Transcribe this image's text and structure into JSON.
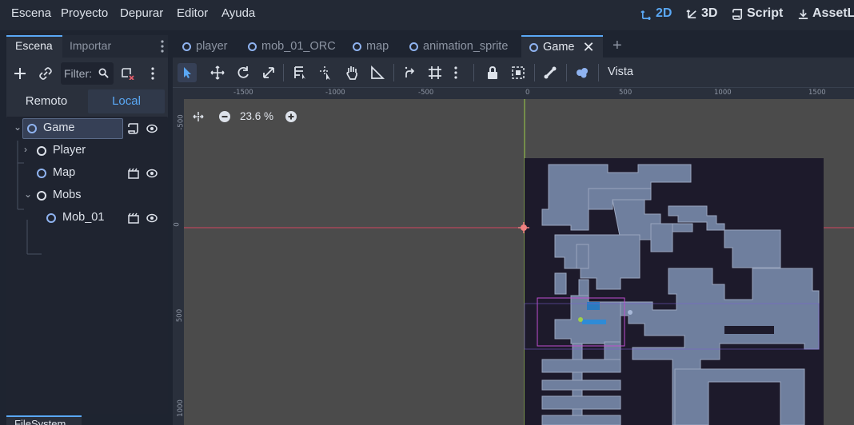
{
  "menu": {
    "items": [
      "Escena",
      "Proyecto",
      "Depurar",
      "Editor",
      "Ayuda"
    ]
  },
  "modes": {
    "two_d": "2D",
    "three_d": "3D",
    "script": "Script",
    "assetlib": "AssetL"
  },
  "scene_dock": {
    "tabs": [
      "Escena",
      "Importar"
    ],
    "filter_placeholder": "Filter:",
    "remote_label": "Remoto",
    "local_label": "Local",
    "tree": [
      {
        "name": "Game",
        "selected": true
      },
      {
        "name": "Player",
        "collapsed": true
      },
      {
        "name": "Map"
      },
      {
        "name": "Mobs",
        "expanded": true
      },
      {
        "name": "Mob_01"
      }
    ]
  },
  "filesystem_tab": "FileSystem",
  "scene_tabs": [
    {
      "label": "player"
    },
    {
      "label": "mob_01_ORC"
    },
    {
      "label": "map"
    },
    {
      "label": "animation_sprite"
    },
    {
      "label": "Game",
      "active": true
    }
  ],
  "toolbar": {
    "vista_label": "Vista"
  },
  "viewport": {
    "zoom_label": "23.6 %",
    "ruler_x_ticks": [
      "-1500",
      "-1000",
      "-500",
      "0",
      "500",
      "1000",
      "1500"
    ],
    "ruler_y_ticks": [
      "-500",
      "0",
      "500",
      "1000"
    ]
  },
  "colors": {
    "accent": "#5aa8f5",
    "map_wall": "#1d1a2b",
    "map_floor": "#6f7f9e",
    "x_axis": "#d0465f",
    "y_axis": "#9ecf4a"
  }
}
